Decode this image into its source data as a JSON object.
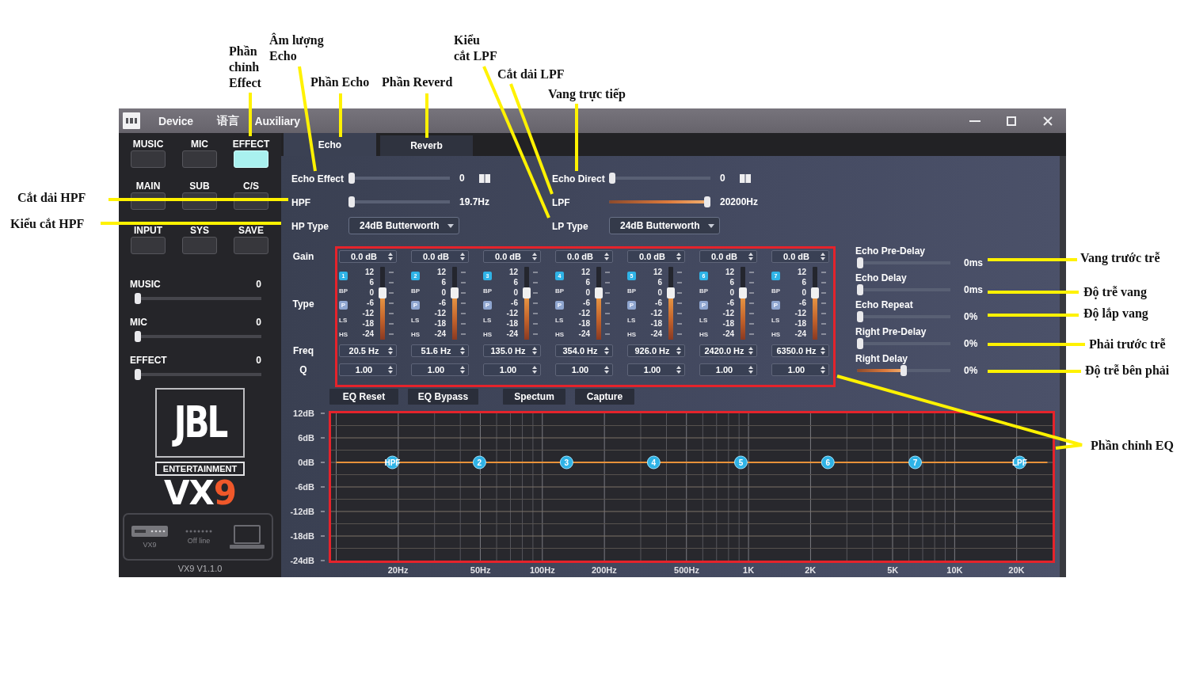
{
  "window": {
    "menu": [
      "Device",
      "语言",
      "Auxiliary"
    ]
  },
  "sidebar": {
    "mode_buttons": [
      {
        "label": "MUSIC",
        "selected": false
      },
      {
        "label": "MIC",
        "selected": false
      },
      {
        "label": "EFFECT",
        "selected": true
      },
      {
        "label": "MAIN",
        "selected": false
      },
      {
        "label": "SUB",
        "selected": false
      },
      {
        "label": "C/S",
        "selected": false
      },
      {
        "label": "INPUT",
        "selected": false
      },
      {
        "label": "SYS",
        "selected": false
      },
      {
        "label": "SAVE",
        "selected": false
      }
    ],
    "volumes": [
      {
        "label": "MUSIC",
        "value": "0",
        "level": 0
      },
      {
        "label": "MIC",
        "value": "0",
        "level": 0
      },
      {
        "label": "EFFECT",
        "value": "0",
        "level": 0
      }
    ],
    "logo": {
      "brand": "JBL",
      "tagline": "ENTERTAINMENT",
      "model": "VX",
      "model_accent": "9"
    },
    "connection": {
      "device": "VX9",
      "status": "Off line"
    },
    "version": "VX9 V1.1.0"
  },
  "tabs": [
    {
      "label": "Echo",
      "selected": true
    },
    {
      "label": "Reverb",
      "selected": false
    }
  ],
  "controls": {
    "left": [
      {
        "kind": "volume",
        "label": "Echo Effect",
        "value": "0",
        "level": 0
      },
      {
        "kind": "filter",
        "label": "HPF",
        "value": "19.7Hz",
        "level": 0
      },
      {
        "kind": "dropdown",
        "label": "HP Type",
        "value": "24dB Butterworth"
      }
    ],
    "right": [
      {
        "kind": "volume",
        "label": "Echo Direct",
        "value": "0",
        "level": 0
      },
      {
        "kind": "filter",
        "label": "LPF",
        "value": "20200Hz",
        "level": 1
      },
      {
        "kind": "dropdown",
        "label": "LP Type",
        "value": "24dB Butterworth"
      }
    ]
  },
  "eq": {
    "row_labels": [
      "Gain",
      "Type",
      "Freq",
      "Q"
    ],
    "bands": [
      {
        "number": "1",
        "gain": "0.0 dB",
        "types": [
          {
            "label": "BP",
            "selected": false
          },
          {
            "label": "P",
            "selected": true
          },
          {
            "label": "LS",
            "selected": false
          },
          {
            "label": "HS",
            "selected": false
          }
        ],
        "scale": [
          "12",
          "6",
          "0",
          "-6",
          "-12",
          "-18",
          "-24"
        ],
        "level": 0.667,
        "freq": "20.5 Hz",
        "q": "1.00"
      },
      {
        "number": "2",
        "gain": "0.0 dB",
        "types": [
          {
            "label": "BP",
            "selected": false
          },
          {
            "label": "P",
            "selected": true
          },
          {
            "label": "LS",
            "selected": false
          },
          {
            "label": "HS",
            "selected": false
          }
        ],
        "scale": [
          "12",
          "6",
          "0",
          "-6",
          "-12",
          "-18",
          "-24"
        ],
        "level": 0.667,
        "freq": "51.6 Hz",
        "q": "1.00"
      },
      {
        "number": "3",
        "gain": "0.0 dB",
        "types": [
          {
            "label": "BP",
            "selected": false
          },
          {
            "label": "P",
            "selected": true
          },
          {
            "label": "LS",
            "selected": false
          },
          {
            "label": "HS",
            "selected": false
          }
        ],
        "scale": [
          "12",
          "6",
          "0",
          "-6",
          "-12",
          "-18",
          "-24"
        ],
        "level": 0.667,
        "freq": "135.0 Hz",
        "q": "1.00"
      },
      {
        "number": "4",
        "gain": "0.0 dB",
        "types": [
          {
            "label": "BP",
            "selected": false
          },
          {
            "label": "P",
            "selected": true
          },
          {
            "label": "LS",
            "selected": false
          },
          {
            "label": "HS",
            "selected": false
          }
        ],
        "scale": [
          "12",
          "6",
          "0",
          "-6",
          "-12",
          "-18",
          "-24"
        ],
        "level": 0.667,
        "freq": "354.0 Hz",
        "q": "1.00"
      },
      {
        "number": "5",
        "gain": "0.0 dB",
        "types": [
          {
            "label": "BP",
            "selected": false
          },
          {
            "label": "P",
            "selected": true
          },
          {
            "label": "LS",
            "selected": false
          },
          {
            "label": "HS",
            "selected": false
          }
        ],
        "scale": [
          "12",
          "6",
          "0",
          "-6",
          "-12",
          "-18",
          "-24"
        ],
        "level": 0.667,
        "freq": "926.0 Hz",
        "q": "1.00"
      },
      {
        "number": "6",
        "gain": "0.0 dB",
        "types": [
          {
            "label": "BP",
            "selected": false
          },
          {
            "label": "P",
            "selected": true
          },
          {
            "label": "LS",
            "selected": false
          },
          {
            "label": "HS",
            "selected": false
          }
        ],
        "scale": [
          "12",
          "6",
          "0",
          "-6",
          "-12",
          "-18",
          "-24"
        ],
        "level": 0.667,
        "freq": "2420.0 Hz",
        "q": "1.00"
      },
      {
        "number": "7",
        "gain": "0.0 dB",
        "types": [
          {
            "label": "BP",
            "selected": false
          },
          {
            "label": "P",
            "selected": true
          },
          {
            "label": "LS",
            "selected": false
          },
          {
            "label": "HS",
            "selected": false
          }
        ],
        "scale": [
          "12",
          "6",
          "0",
          "-6",
          "-12",
          "-18",
          "-24"
        ],
        "level": 0.667,
        "freq": "6350.0 Hz",
        "q": "1.00"
      }
    ],
    "buttons": [
      "EQ Reset",
      "EQ Bypass",
      "Spectum",
      "Capture"
    ],
    "graph": {
      "chart_data": {
        "type": "line",
        "grid": true,
        "categories": [
          null,
          null,
          null,
          null,
          null,
          null,
          "20Hz",
          null,
          null,
          null,
          null,
          null,
          null,
          null,
          "50Hz",
          null,
          null,
          null,
          null,
          null,
          "100Hz",
          null,
          null,
          null,
          null,
          null,
          "200Hz",
          null,
          null,
          null,
          null,
          null,
          null,
          null,
          "500Hz",
          null,
          null,
          null,
          null,
          null,
          "1K",
          null,
          null,
          null,
          null,
          null,
          "2K",
          null,
          null,
          null,
          null,
          null,
          null,
          null,
          "5K",
          null,
          null,
          null,
          null,
          null,
          "10K",
          null,
          null,
          null,
          null,
          null,
          "20K",
          null,
          null,
          null
        ],
        "series": [
          {
            "color": "#e8923a",
            "values": [
              0,
              0,
              0,
              0,
              0,
              0,
              0,
              0,
              0,
              0,
              0,
              0,
              0,
              0,
              0,
              0,
              0,
              0,
              0,
              0,
              0,
              0,
              0,
              0,
              0,
              0,
              0,
              0,
              0,
              0,
              0,
              0,
              0,
              0,
              0,
              0,
              0,
              0,
              0,
              0,
              0,
              0,
              0,
              0,
              0,
              0,
              0,
              0,
              0,
              0,
              0,
              0,
              0,
              0,
              0,
              0,
              0,
              0,
              0,
              0,
              0,
              0,
              0,
              0,
              0,
              0,
              0,
              0,
              0,
              0
            ]
          }
        ],
        "ylim": [
          -24,
          12
        ],
        "yticks": [
          {
            "value": 12,
            "label": "12dB"
          },
          {
            "value": 6,
            "label": "6dB"
          },
          {
            "value": 0,
            "label": "0dB"
          },
          {
            "value": -6,
            "label": "-6dB"
          },
          {
            "value": -12,
            "label": "-12dB"
          },
          {
            "value": -18,
            "label": "-18dB"
          },
          {
            "value": -24,
            "label": "-24dB"
          }
        ]
      },
      "markers": [
        "HPF",
        "2",
        "3",
        "4",
        "5",
        "6",
        "7",
        "LPF"
      ]
    }
  },
  "delays": [
    {
      "label": "Echo Pre-Delay",
      "value": "0ms",
      "level": 0
    },
    {
      "label": "Echo Delay",
      "value": "0ms",
      "level": 0
    },
    {
      "label": "Echo Repeat",
      "value": "0%",
      "level": 0
    },
    {
      "label": "Right Pre-Delay",
      "value": "0%",
      "level": 0
    },
    {
      "label": "Right Delay",
      "value": "0%",
      "level": 0.5
    }
  ],
  "callouts": [
    {
      "text": "Phần\nchỉnh\nEffect"
    },
    {
      "text": "Âm lượng\nEcho"
    },
    {
      "text": "Phần Echo"
    },
    {
      "text": "Phần Reverd"
    },
    {
      "text": "Kiểu\ncắt LPF"
    },
    {
      "text": "Cắt dải LPF"
    },
    {
      "text": "Vang trực tiếp"
    },
    {
      "text": "Cắt dải HPF"
    },
    {
      "text": "Kiểu cắt HPF"
    },
    {
      "text": "Vang trước trễ"
    },
    {
      "text": "Độ trễ vang"
    },
    {
      "text": "Độ lắp vang"
    },
    {
      "text": "Phải trước trễ"
    },
    {
      "text": "Độ trễ bên phải"
    },
    {
      "text": "Phần chỉnh EQ"
    }
  ]
}
